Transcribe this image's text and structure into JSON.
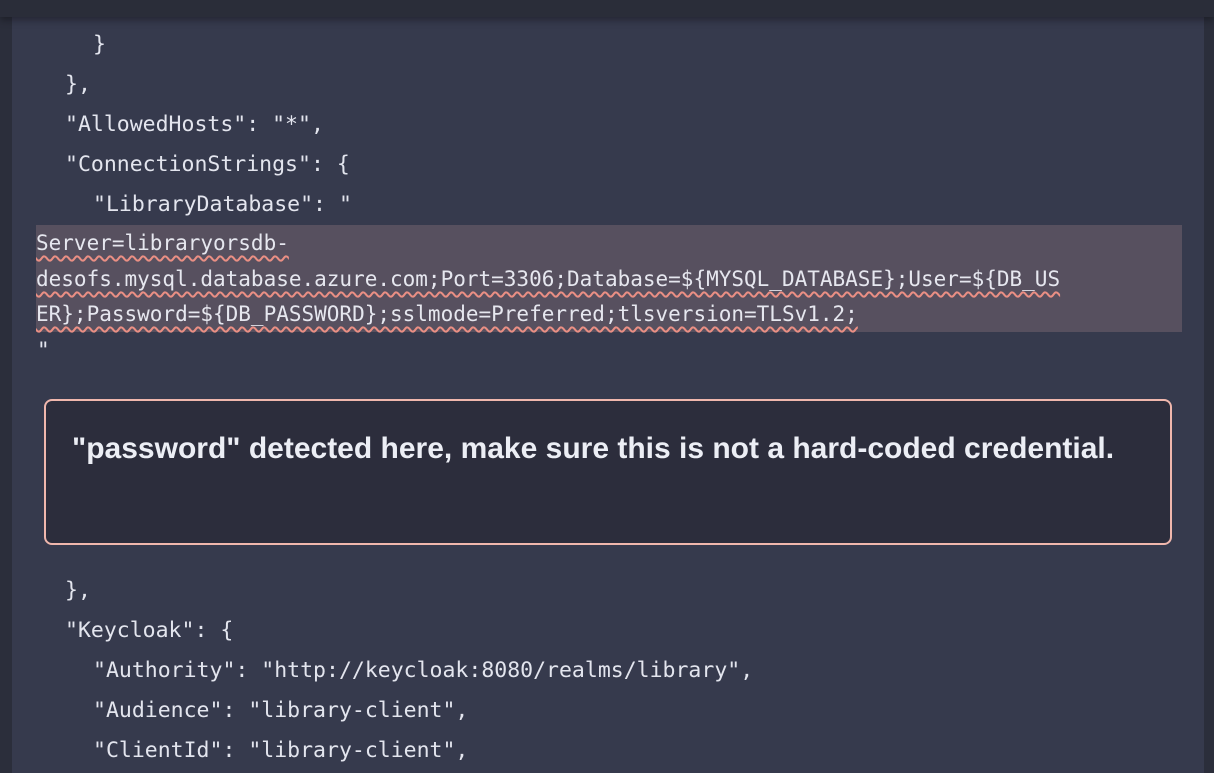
{
  "code": {
    "lines_before": [
      "}",
      "},",
      "\"AllowedHosts\": \"*\",",
      "\"ConnectionStrings\": {",
      "\"LibraryDatabase\": \""
    ],
    "flagged_lines": [
      "Server=libraryorsdb-",
      "desofs.mysql.database.azure.com;Port=3306;Database=${MYSQL_DATABASE};User=${DB_US",
      "ER};Password=${DB_PASSWORD};sslmode=Preferred;tlsversion=TLSv1.2;"
    ],
    "closing_quote": "\"",
    "lines_after": [
      "},",
      "\"Keycloak\": {",
      "\"Authority\": \"http://keycloak:8080/realms/library\",",
      "\"Audience\": \"library-client\",",
      "\"ClientId\": \"library-client\","
    ]
  },
  "warning": {
    "message": "\"password\" detected here, make sure this is not a hard-coded credential.",
    "border_color": "#f0b7ad"
  },
  "colors": {
    "code_background": "#363a4d",
    "highlight_background": "#57505f",
    "squiggle": "#ea8f84"
  }
}
